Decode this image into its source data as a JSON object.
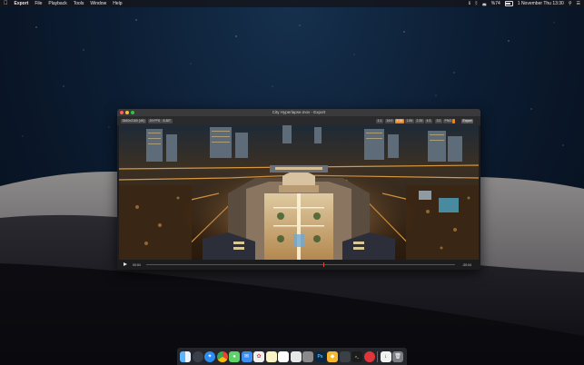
{
  "menubar": {
    "app_name": "Export",
    "menus": [
      "File",
      "Playback",
      "Tools",
      "Window",
      "Help"
    ],
    "battery": "%74",
    "datetime": "1 November Thu  13:30"
  },
  "window": {
    "title": "City Hyperlapse.mov - Export",
    "info_resolution": "3840x2160 (4K)",
    "info_fps": "29 FPS",
    "info_bit": "8-BIT",
    "aspect_ratios": [
      "1:1",
      "16:9",
      "9:16",
      "1.85",
      "2.35",
      "4:3",
      "3:2"
    ],
    "aspect_selected": "9:16",
    "format": "PNG",
    "export_label": "Export",
    "time_current": "00:04",
    "time_remaining": "-00:04",
    "progress": 0.0
  },
  "dock": {
    "icons": [
      "finder-icon",
      "launchpad-icon",
      "safari-icon",
      "chrome-icon",
      "messages-icon",
      "mail-icon",
      "photos-icon",
      "notes-icon",
      "textedit-icon",
      "preview-icon",
      "pages-icon",
      "photoshop-icon",
      "sketch-icon",
      "xcode-icon",
      "terminal-icon",
      "app-store-icon",
      "downloads-icon",
      "trash-icon"
    ],
    "photoshop_label": "Ps"
  }
}
